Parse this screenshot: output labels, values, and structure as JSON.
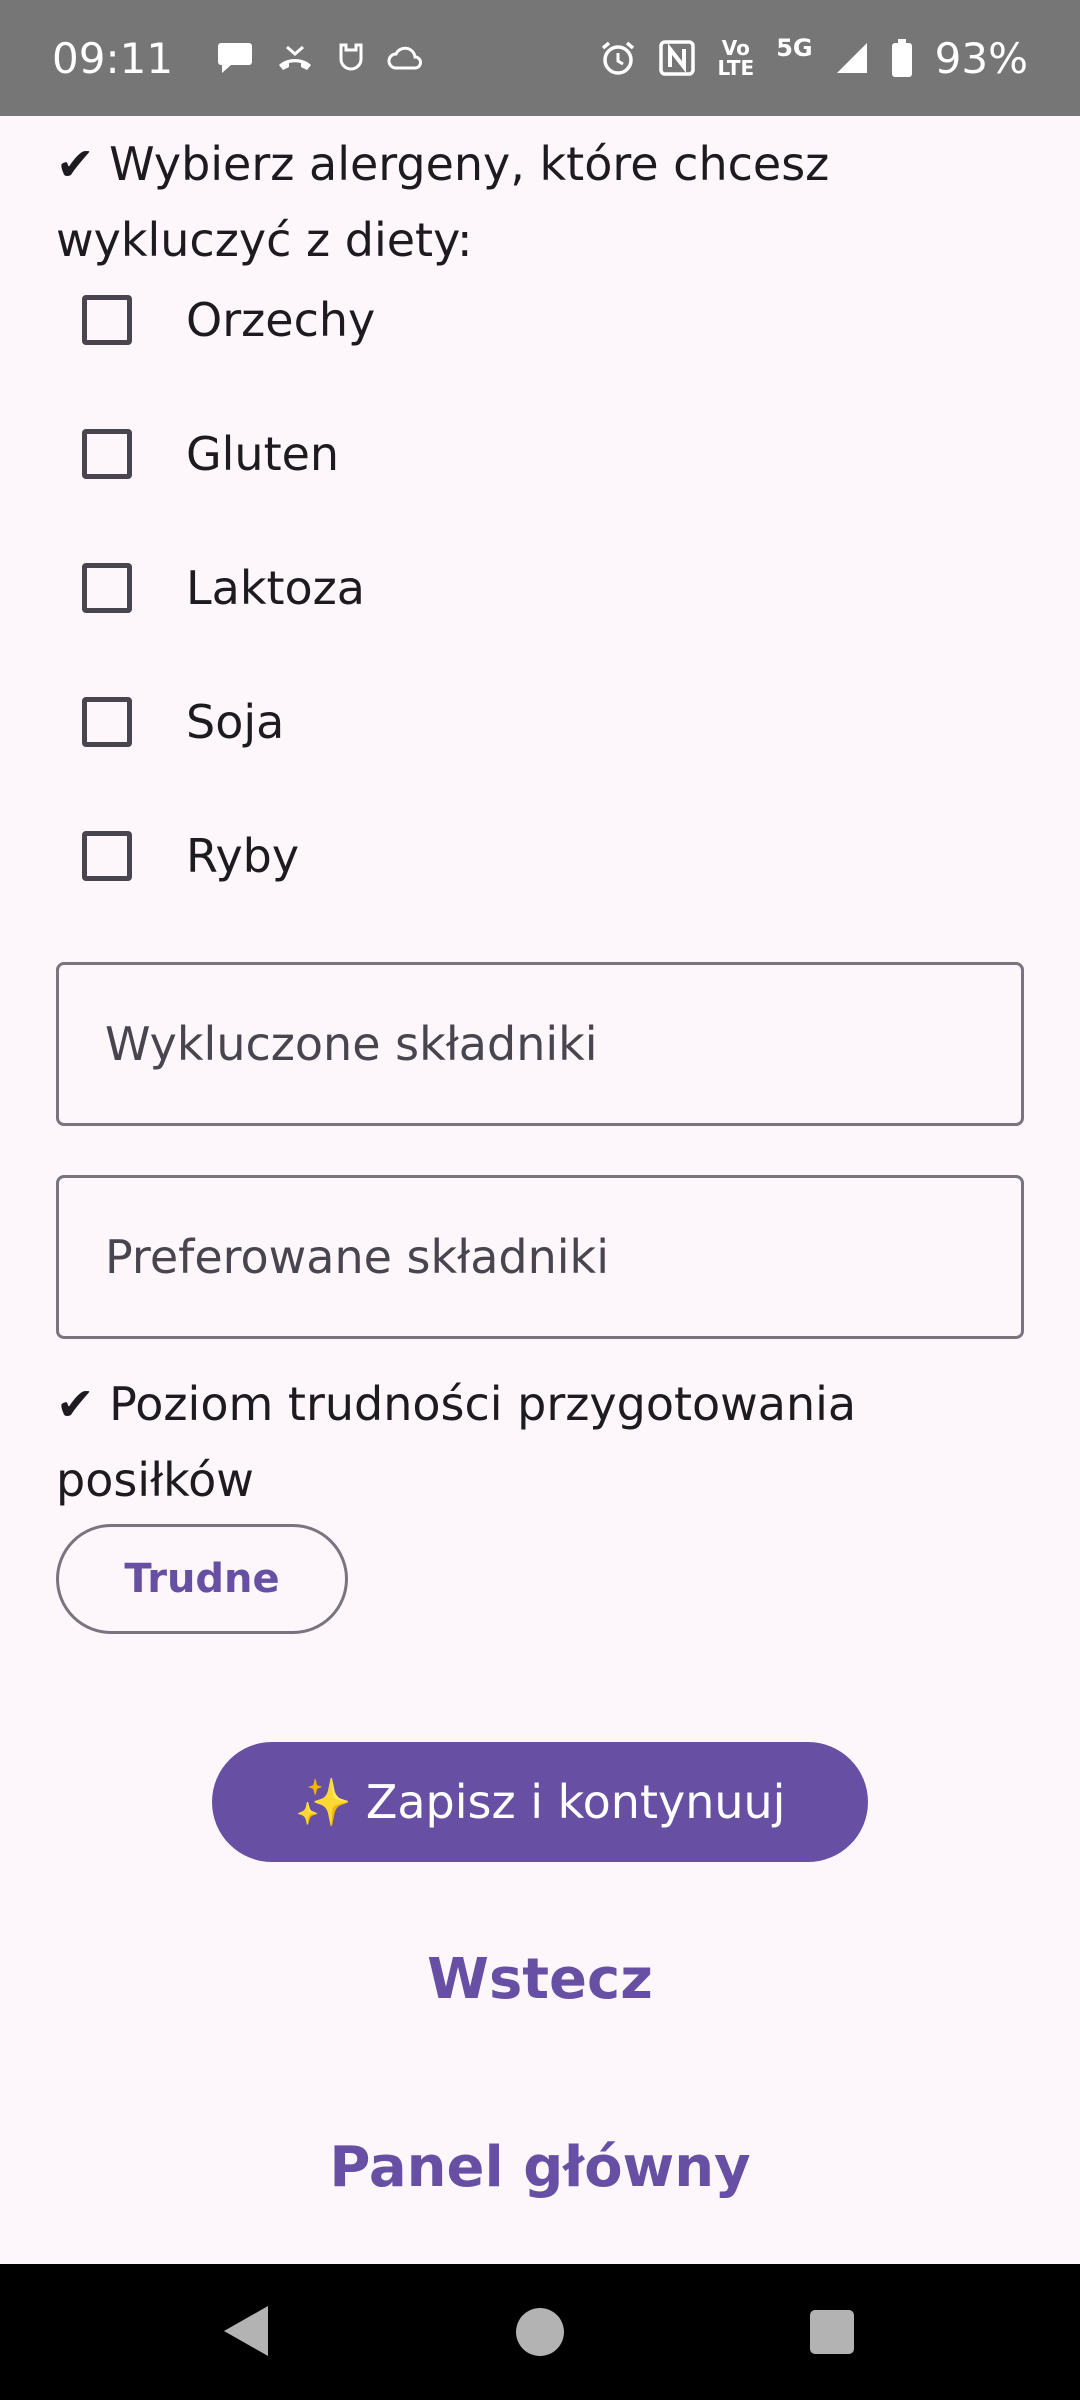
{
  "status_bar": {
    "time": "09:11",
    "notification_icons": [
      "chat-bubble-icon",
      "missed-call-icon",
      "shield-icon",
      "cloud-icon"
    ],
    "system_icons": [
      "alarm-icon",
      "nfc-icon",
      "volte-icon",
      "5g-icon",
      "signal-icon",
      "battery-icon"
    ],
    "volte_label_top": "Vo",
    "volte_label_bottom": "LTE",
    "network_label": "5G",
    "battery_percent": "93%"
  },
  "allergens": {
    "check_mark": "✔",
    "title": "Wybierz alergeny, które chcesz wykluczyć z diety:",
    "items": [
      {
        "label": "Orzechy",
        "checked": false
      },
      {
        "label": "Gluten",
        "checked": false
      },
      {
        "label": "Laktoza",
        "checked": false
      },
      {
        "label": "Soja",
        "checked": false
      },
      {
        "label": "Ryby",
        "checked": false
      }
    ]
  },
  "fields": {
    "excluded_placeholder": "Wykluczone składniki",
    "excluded_value": "",
    "preferred_placeholder": "Preferowane składniki",
    "preferred_value": ""
  },
  "difficulty": {
    "check_mark": "✔",
    "title": "Poziom trudności przygotowania posiłków",
    "selected": "Trudne"
  },
  "actions": {
    "save_icon": "✨",
    "save_label": "Zapisz i kontynuuj",
    "back_label": "Wstecz",
    "home_label": "Panel główny"
  },
  "colors": {
    "primary": "#6750A4",
    "background": "#FDF7FC",
    "status_bar": "#767676",
    "outline": "#79747E"
  }
}
